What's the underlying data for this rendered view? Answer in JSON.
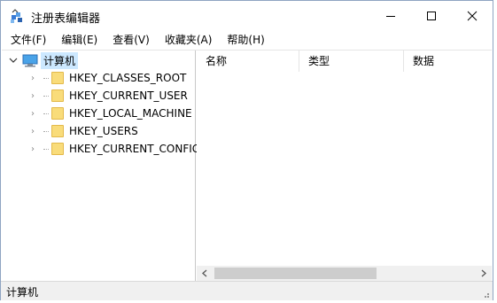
{
  "window": {
    "title": "注册表编辑器"
  },
  "menu": [
    "文件(F)",
    "编辑(E)",
    "查看(V)",
    "收藏夹(A)",
    "帮助(H)"
  ],
  "tree": {
    "root_label": "计算机",
    "keys": [
      "HKEY_CLASSES_ROOT",
      "HKEY_CURRENT_USER",
      "HKEY_LOCAL_MACHINE",
      "HKEY_USERS",
      "HKEY_CURRENT_CONFIG"
    ]
  },
  "list": {
    "columns": [
      "名称",
      "类型",
      "数据"
    ]
  },
  "status": {
    "path": "计算机"
  },
  "colors": {
    "selection": "#cce8ff",
    "folder": "#f9dc7a",
    "scroll_thumb": "#cdcdcd"
  },
  "icons": {
    "app": "registry-editor-icon",
    "computer": "computer-icon",
    "folder": "folder-icon"
  }
}
